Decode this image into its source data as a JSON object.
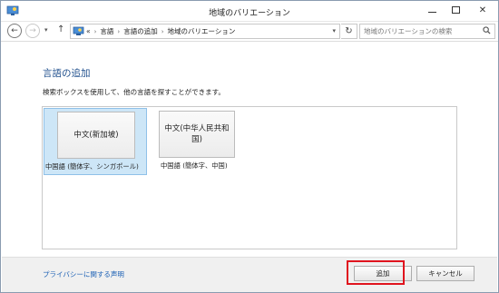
{
  "window": {
    "title": "地域のバリエーション",
    "icon": "control-panel-icon"
  },
  "address_bar": {
    "overflow": "«",
    "breadcrumbs": [
      "言語",
      "言語の追加",
      "地域のバリエーション"
    ],
    "search_placeholder": "地域のバリエーションの検索"
  },
  "main": {
    "heading": "言語の追加",
    "description": "検索ボックスを使用して、他の言語を探すことができます。",
    "languages": [
      {
        "tile": "中文(新加坡)",
        "caption": "中国語 (簡体字、シンガポール)",
        "selected": true
      },
      {
        "tile": "中文(中华人民共和国)",
        "caption": "中国語 (簡体字、中国)",
        "selected": false
      }
    ]
  },
  "footer": {
    "privacy_link": "プライバシーに関する声明",
    "add_button": "追加",
    "cancel_button": "キャンセル"
  },
  "colors": {
    "heading": "#1e4e8c",
    "selection": "#cde6f7",
    "link": "#1a5fb4",
    "highlight": "#e0141e"
  }
}
